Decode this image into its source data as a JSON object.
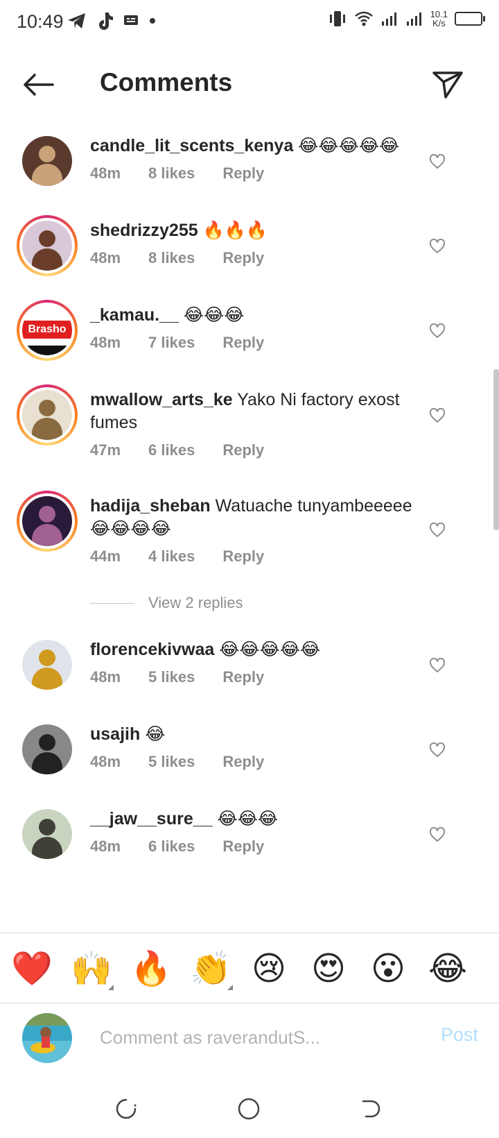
{
  "status_bar": {
    "time": "10:49",
    "speed_value": "10.1",
    "speed_unit": "K/s"
  },
  "header": {
    "title": "Comments",
    "back_icon": "arrow-left-icon",
    "share_icon": "send-icon"
  },
  "comments": [
    {
      "username": "candle_lit_scents_kenya",
      "text": " 😂😂😂😂😂",
      "time": "48m",
      "likes": "8 likes",
      "reply": "Reply",
      "ring": false,
      "avatar_colors": [
        "#5b3a2e",
        "#c9a27a"
      ]
    },
    {
      "username": "shedrizzy255",
      "text": " 🔥🔥🔥",
      "time": "48m",
      "likes": "8 likes",
      "reply": "Reply",
      "ring": true,
      "avatar_colors": [
        "#d8c8d8",
        "#6a3d2a"
      ]
    },
    {
      "username": "_kamau.__",
      "text": " 😂😂😂",
      "time": "48m",
      "likes": "7 likes",
      "reply": "Reply",
      "ring": true,
      "avatar_badge": "Brasho",
      "avatar_colors": [
        "#ffffff",
        "#e02020"
      ]
    },
    {
      "username": "mwallow_arts_ke",
      "text": " Yako Ni factory exost fumes",
      "time": "47m",
      "likes": "6 likes",
      "reply": "Reply",
      "ring": true,
      "avatar_colors": [
        "#e8e0d0",
        "#8a6a40"
      ]
    },
    {
      "username": "hadija_sheban",
      "text": " Watuache tunyambeeeee😂😂😂😂",
      "time": "44m",
      "likes": "4 likes",
      "reply": "Reply",
      "ring": true,
      "avatar_colors": [
        "#2a1a3a",
        "#a06090"
      ]
    },
    {
      "username": "florencekivwaa",
      "text": " 😂😂😂😂😂",
      "time": "48m",
      "likes": "5 likes",
      "reply": "Reply",
      "ring": false,
      "avatar_colors": [
        "#e0e4ea",
        "#d09a20"
      ]
    },
    {
      "username": "usajih",
      "text": " 😂",
      "time": "48m",
      "likes": "5 likes",
      "reply": "Reply",
      "ring": false,
      "avatar_colors": [
        "#888888",
        "#222222"
      ]
    },
    {
      "username": "__jaw__sure__",
      "text": " 😂😂😂",
      "time": "48m",
      "likes": "6 likes",
      "reply": "Reply",
      "ring": false,
      "avatar_colors": [
        "#c8d4c0",
        "#404038"
      ]
    }
  ],
  "view_replies": "View 2 replies",
  "emoji_bar": [
    "❤️",
    "🙌",
    "🔥",
    "👏",
    "😢",
    "😍",
    "😮",
    "😂"
  ],
  "input": {
    "placeholder": "Comment as raverandutS...",
    "post_label": "Post"
  },
  "navbar": {
    "recent_icon": "recents-icon",
    "home_icon": "home-circle-icon",
    "back_icon": "nav-back-icon"
  },
  "colors": {
    "link_disabled": "#b2dffc",
    "meta_gray": "#8e8e8e"
  }
}
